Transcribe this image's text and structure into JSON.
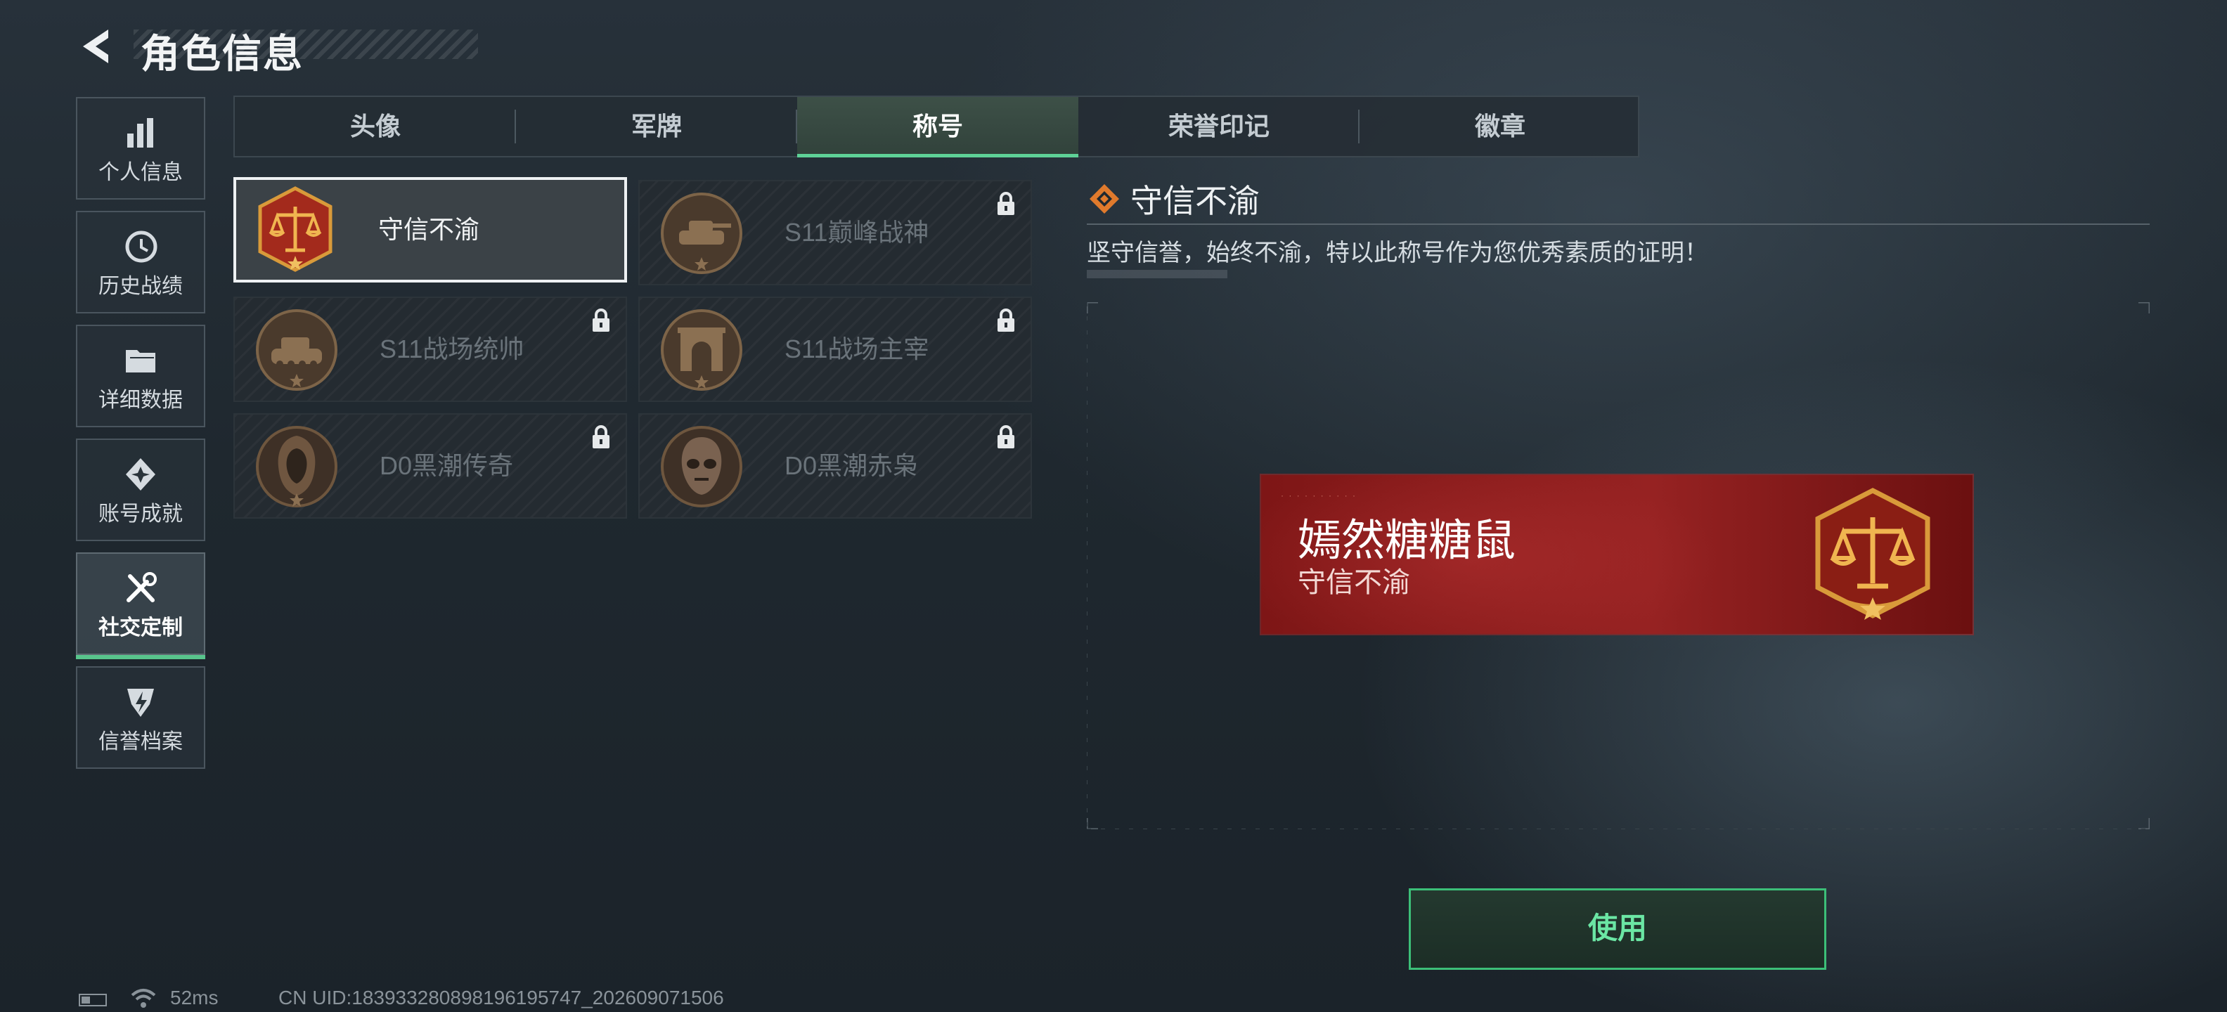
{
  "header": {
    "title": "角色信息"
  },
  "sidebar": {
    "items": [
      {
        "label": "个人信息",
        "icon": "bar-chart-icon"
      },
      {
        "label": "历史战绩",
        "icon": "history-clock-icon"
      },
      {
        "label": "详细数据",
        "icon": "folder-icon"
      },
      {
        "label": "账号成就",
        "icon": "achievement-icon"
      },
      {
        "label": "社交定制",
        "icon": "tools-icon",
        "active": true
      },
      {
        "label": "信誉档案",
        "icon": "shield-bolt-icon"
      }
    ]
  },
  "tabs": [
    {
      "label": "头像"
    },
    {
      "label": "军牌"
    },
    {
      "label": "称号",
      "active": true
    },
    {
      "label": "荣誉印记"
    },
    {
      "label": "徽章"
    }
  ],
  "titles": [
    {
      "name": "守信不渝",
      "selected": true,
      "locked": false,
      "icon": "scales-emblem-icon"
    },
    {
      "name": "S11巅峰战神",
      "locked": true,
      "icon": "tank-emblem-icon"
    },
    {
      "name": "S11战场统帅",
      "locked": true,
      "icon": "tank-emblem-icon"
    },
    {
      "name": "S11战场主宰",
      "locked": true,
      "icon": "arch-emblem-icon"
    },
    {
      "name": "D0黑潮传奇",
      "locked": true,
      "icon": "hooded-figure-emblem-icon"
    },
    {
      "name": "D0黑潮赤枭",
      "locked": true,
      "icon": "skull-mask-emblem-icon"
    }
  ],
  "detail": {
    "title": "守信不渝",
    "description": "坚守信誉，始终不渝，特以此称号作为您优秀素质的证明！",
    "preview": {
      "nickname": "嫣然糖糖鼠",
      "title": "守信不渝"
    }
  },
  "actions": {
    "use_label": "使用"
  },
  "status": {
    "ping": "52ms",
    "uid": "CN UID:183933280898196195747_202609071506"
  },
  "colors": {
    "accent_green": "#5ed197",
    "banner_red": "#962222",
    "emblem_gold": "#d99a3a"
  }
}
